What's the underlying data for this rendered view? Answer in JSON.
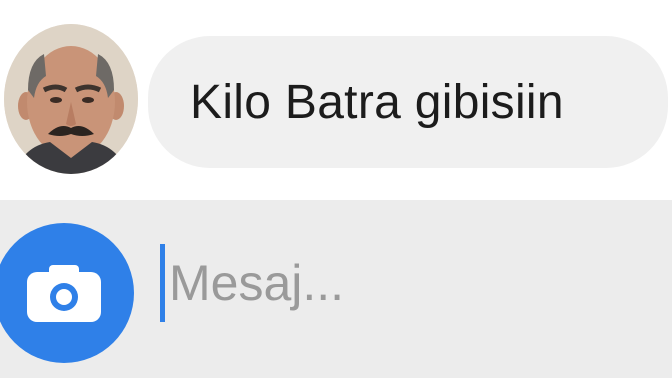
{
  "conversation": {
    "message": {
      "text": "Kilo Batra gibisiin"
    }
  },
  "composer": {
    "placeholder": "Mesaj...",
    "value": "",
    "camera_icon": "camera-icon",
    "accent_color": "#2f80e8"
  },
  "colors": {
    "bubble_bg": "#f0f0f0",
    "composer_bg": "#ececec",
    "text": "#1c1c1c",
    "placeholder": "#9a9a9a"
  }
}
